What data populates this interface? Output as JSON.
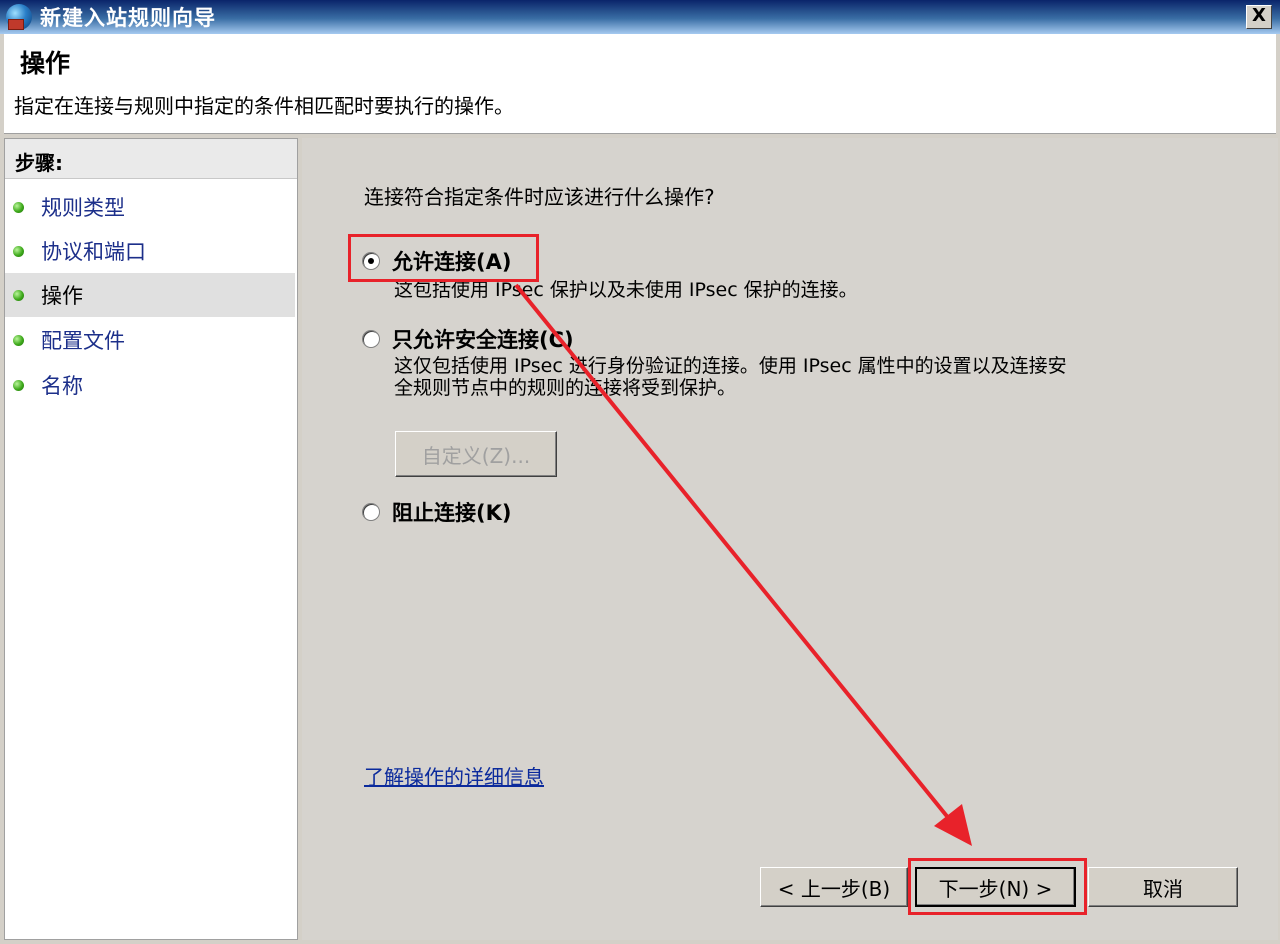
{
  "window": {
    "title": "新建入站规则向导",
    "close_label": "X"
  },
  "header": {
    "title": "操作",
    "description": "指定在连接与规则中指定的条件相匹配时要执行的操作。"
  },
  "sidebar": {
    "heading": "步骤:",
    "items": [
      {
        "label": "规则类型"
      },
      {
        "label": "协议和端口"
      },
      {
        "label": "操作"
      },
      {
        "label": "配置文件"
      },
      {
        "label": "名称"
      }
    ],
    "current_index": 2
  },
  "main": {
    "question": "连接符合指定条件时应该进行什么操作?",
    "options": [
      {
        "label": "允许连接(A)",
        "description": "这包括使用 IPsec 保护以及未使用 IPsec 保护的连接。",
        "checked": true
      },
      {
        "label": "只允许安全连接(C)",
        "description_line1": "这仅包括使用 IPsec 进行身份验证的连接。使用 IPsec 属性中的设置以及连接安",
        "description_line2": "全规则节点中的规则的连接将受到保护。",
        "checked": false
      },
      {
        "label": "阻止连接(K)",
        "checked": false
      }
    ],
    "customize_label": "自定义(Z)...",
    "learn_more_link": "了解操作的详细信息"
  },
  "footer": {
    "back_label": "< 上一步(B)",
    "next_label": "下一步(N) >",
    "cancel_label": "取消"
  },
  "colors": {
    "highlight": "#e8222a",
    "titlebar": "#0a246a",
    "link": "#0b2a9c"
  }
}
